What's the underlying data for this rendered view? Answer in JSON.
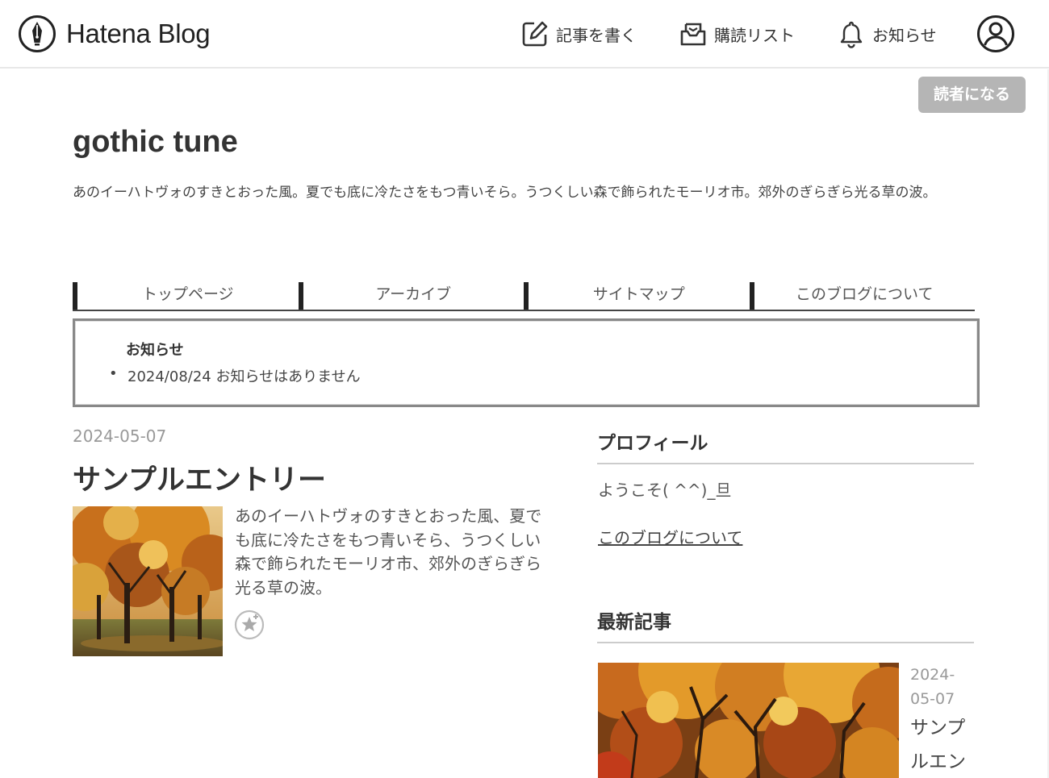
{
  "header": {
    "logo_text": "Hatena Blog",
    "write_label": "記事を書く",
    "subscribe_label": "購読リスト",
    "notifications_label": "お知らせ",
    "reader_button": "読者になる"
  },
  "blog": {
    "title": "gothic tune",
    "description": "あのイーハトヴォのすきとおった風。夏でも底に冷たさをもつ青いそら。うつくしい森で飾られたモーリオ市。郊外のぎらぎら光る草の波。"
  },
  "nav": {
    "items": [
      {
        "label": "トップページ"
      },
      {
        "label": "アーカイブ"
      },
      {
        "label": "サイトマップ"
      },
      {
        "label": "このブログについて"
      }
    ]
  },
  "notice": {
    "heading": "お知らせ",
    "items": [
      {
        "text": "2024/08/24 お知らせはありません"
      }
    ]
  },
  "entry": {
    "date": "2024-05-07",
    "title": "サンプルエントリー",
    "summary": "あのイーハトヴォのすきとおった風、夏でも底に冷たさをもつ青いそら、うつくしい森で飾られたモーリオ市、郊外のぎらぎら光る草の波。"
  },
  "sidebar": {
    "profile_heading": "プロフィール",
    "profile_text": "ようこそ( ^^)_旦",
    "profile_link": "このブログについて",
    "recent_heading": "最新記事",
    "recent_date": "2024-05-07",
    "recent_title": "サンプルエン"
  },
  "colors": {
    "accent_button": "#b5b5b5",
    "text": "#333333",
    "muted": "#999999",
    "rule": "#cccccc"
  },
  "icons": [
    "hatena-pen-logo-icon",
    "pencil-square-icon",
    "inbox-mail-icon",
    "bell-icon",
    "user-circle-icon",
    "add-star-icon"
  ]
}
